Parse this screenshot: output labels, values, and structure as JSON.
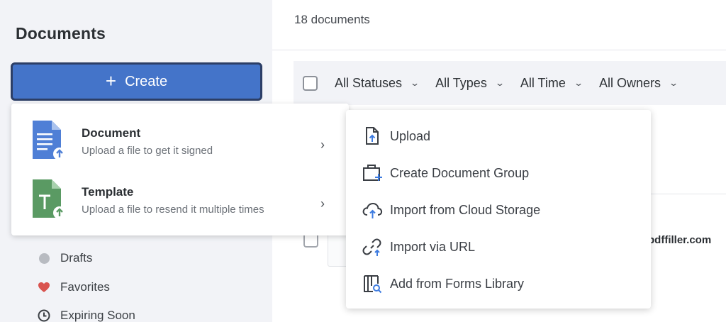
{
  "sidebar": {
    "title": "Documents",
    "create_label": "Create",
    "nav": [
      {
        "label": "Drafts",
        "icon": "circle-icon",
        "color": "#b8bbc1"
      },
      {
        "label": "Favorites",
        "icon": "heart-icon",
        "color": "#d9534f"
      },
      {
        "label": "Expiring Soon",
        "icon": "clock-icon",
        "color": "#3c4045"
      }
    ]
  },
  "main": {
    "count_label": "18 documents",
    "filters": [
      "All Statuses",
      "All Types",
      "All Time",
      "All Owners"
    ],
    "row_email_fragment": "pdffiller.com"
  },
  "create_menu": {
    "items": [
      {
        "title": "Document",
        "subtitle": "Upload a file to get it signed",
        "icon": "document-file-icon",
        "color": "#4f7fd6"
      },
      {
        "title": "Template",
        "subtitle": "Upload a file to resend it multiple times",
        "icon": "template-file-icon",
        "color": "#5a9a63"
      }
    ]
  },
  "sub_menu": {
    "items": [
      {
        "label": "Upload",
        "icon": "upload-file-icon"
      },
      {
        "label": "Create Document Group",
        "icon": "folder-plus-icon"
      },
      {
        "label": "Import from Cloud Storage",
        "icon": "cloud-upload-icon"
      },
      {
        "label": "Import via URL",
        "icon": "link-icon"
      },
      {
        "label": "Add from Forms Library",
        "icon": "forms-library-icon"
      }
    ]
  },
  "colors": {
    "accent": "#4474c9",
    "sidebar_bg": "#f2f3f7",
    "document_blue": "#4f7fd6",
    "template_green": "#5a9a63",
    "icon_blue": "#3d7be0"
  }
}
